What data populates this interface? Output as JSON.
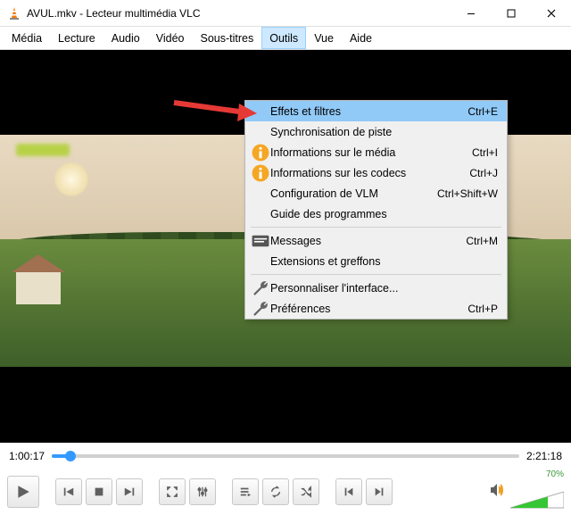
{
  "window": {
    "title": "AVUL.mkv - Lecteur multimédia VLC"
  },
  "menubar": {
    "items": [
      "Média",
      "Lecture",
      "Audio",
      "Vidéo",
      "Sous-titres",
      "Outils",
      "Vue",
      "Aide"
    ],
    "open_index": 5
  },
  "dropdown": {
    "items": [
      {
        "icon": "",
        "label": "Effets et filtres",
        "shortcut": "Ctrl+E",
        "hover": true
      },
      {
        "icon": "",
        "label": "Synchronisation de piste",
        "shortcut": ""
      },
      {
        "icon": "info",
        "label": "Informations sur le média",
        "shortcut": "Ctrl+I"
      },
      {
        "icon": "info",
        "label": "Informations sur les codecs",
        "shortcut": "Ctrl+J"
      },
      {
        "icon": "",
        "label": "Configuration de VLM",
        "shortcut": "Ctrl+Shift+W"
      },
      {
        "icon": "",
        "label": "Guide des programmes",
        "shortcut": ""
      },
      {
        "sep": true
      },
      {
        "icon": "msg",
        "label": "Messages",
        "shortcut": "Ctrl+M"
      },
      {
        "icon": "",
        "label": "Extensions et greffons",
        "shortcut": ""
      },
      {
        "sep": true
      },
      {
        "icon": "wrench",
        "label": "Personnaliser l'interface...",
        "shortcut": ""
      },
      {
        "icon": "wrench",
        "label": "Préférences",
        "shortcut": "Ctrl+P"
      }
    ]
  },
  "playback": {
    "current_time": "1:00:17",
    "total_time": "2:21:18",
    "progress_percent": 4
  },
  "volume": {
    "percent_label": "70%",
    "percent": 70
  }
}
